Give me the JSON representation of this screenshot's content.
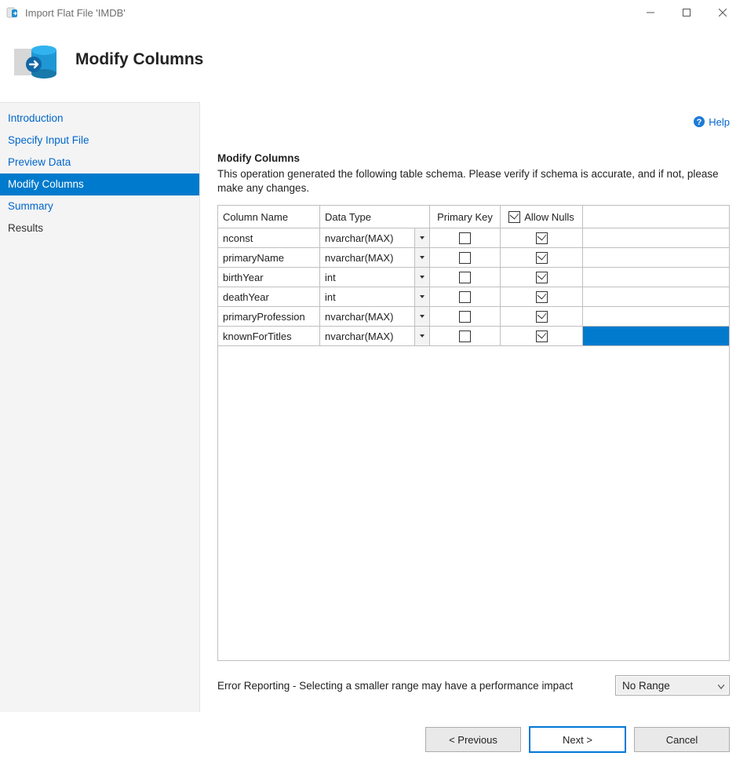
{
  "window": {
    "title": "Import Flat File 'IMDB'"
  },
  "header": {
    "title": "Modify Columns"
  },
  "help": {
    "label": "Help"
  },
  "nav": {
    "items": [
      {
        "label": "Introduction",
        "active": false,
        "link": true
      },
      {
        "label": "Specify Input File",
        "active": false,
        "link": true
      },
      {
        "label": "Preview Data",
        "active": false,
        "link": true
      },
      {
        "label": "Modify Columns",
        "active": true,
        "link": true
      },
      {
        "label": "Summary",
        "active": false,
        "link": true
      },
      {
        "label": "Results",
        "active": false,
        "link": false
      }
    ]
  },
  "section": {
    "title": "Modify Columns",
    "description": "This operation generated the following table schema. Please verify if schema is accurate, and if not, please make any changes."
  },
  "table": {
    "headers": {
      "column_name": "Column Name",
      "data_type": "Data Type",
      "primary_key": "Primary Key",
      "allow_nulls": "Allow Nulls",
      "allow_nulls_all_checked": true
    },
    "rows": [
      {
        "name": "nconst",
        "type": "nvarchar(MAX)",
        "pk": false,
        "nulls": true,
        "selected": false
      },
      {
        "name": "primaryName",
        "type": "nvarchar(MAX)",
        "pk": false,
        "nulls": true,
        "selected": false
      },
      {
        "name": "birthYear",
        "type": "int",
        "pk": false,
        "nulls": true,
        "selected": false
      },
      {
        "name": "deathYear",
        "type": "int",
        "pk": false,
        "nulls": true,
        "selected": false
      },
      {
        "name": "primaryProfession",
        "type": "nvarchar(MAX)",
        "pk": false,
        "nulls": true,
        "selected": false
      },
      {
        "name": "knownForTitles",
        "type": "nvarchar(MAX)",
        "pk": false,
        "nulls": true,
        "selected": true
      }
    ]
  },
  "error_reporting": {
    "label": "Error Reporting - Selecting a smaller range may have a performance impact",
    "selected": "No Range"
  },
  "buttons": {
    "previous": "< Previous",
    "next": "Next >",
    "cancel": "Cancel"
  }
}
